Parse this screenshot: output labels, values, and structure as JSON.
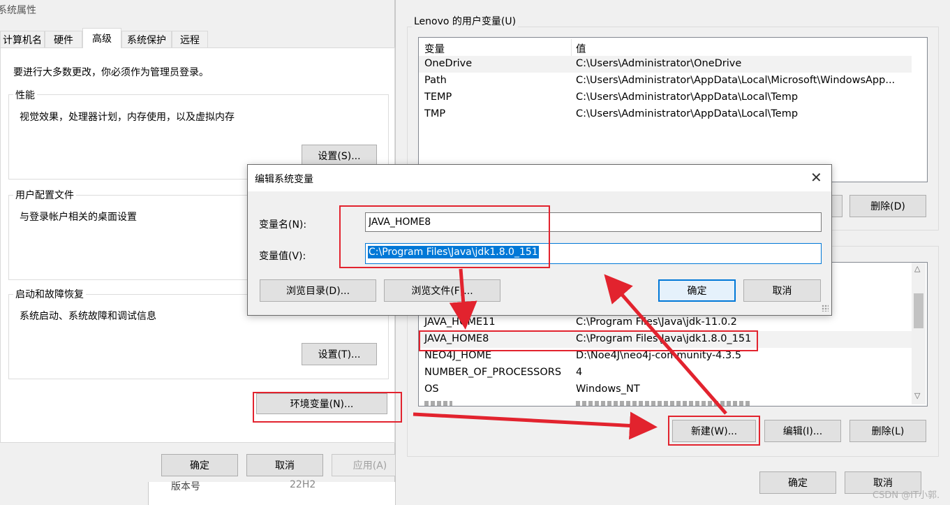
{
  "left_window": {
    "title": "系统属性",
    "tabs": [
      {
        "label": "计算机名"
      },
      {
        "label": "硬件"
      },
      {
        "label": "高级"
      },
      {
        "label": "系统保护"
      },
      {
        "label": "远程"
      }
    ],
    "admin_note": "要进行大多数更改，你必须作为管理员登录。",
    "performance": {
      "title": "性能",
      "desc": "视觉效果，处理器计划，内存使用，以及虚拟内存",
      "button": "设置(S)..."
    },
    "user_profiles": {
      "title": "用户配置文件",
      "desc": "与登录帐户相关的桌面设置"
    },
    "startup": {
      "title": "启动和故障恢复",
      "desc": "系统启动、系统故障和调试信息",
      "button": "设置(T)..."
    },
    "env_button": "环境变量(N)...",
    "ok": "确定",
    "cancel": "取消",
    "apply": "应用(A)",
    "behind_text_1": "版本号",
    "behind_text_2": "22H2"
  },
  "right_window": {
    "user_vars_title": "Lenovo 的用户变量(U)",
    "columns": {
      "name": "变量",
      "value": "值"
    },
    "user_vars": [
      {
        "name": "OneDrive",
        "value": "C:\\Users\\Administrator\\OneDrive"
      },
      {
        "name": "Path",
        "value": "C:\\Users\\Administrator\\AppData\\Local\\Microsoft\\WindowsApp..."
      },
      {
        "name": "TEMP",
        "value": "C:\\Users\\Administrator\\AppData\\Local\\Temp"
      },
      {
        "name": "TMP",
        "value": "C:\\Users\\Administrator\\AppData\\Local\\Temp"
      }
    ],
    "user_delete": "删除(D)",
    "system_vars": [
      {
        "name": "JAVA_HOME11",
        "value": "C:\\Program Files\\Java\\jdk-11.0.2"
      },
      {
        "name": "JAVA_HOME8",
        "value": "C:\\Program Files\\Java\\jdk1.8.0_151"
      },
      {
        "name": "NEO4J_HOME",
        "value": "D:\\Noe4J\\neo4j-community-4.3.5"
      },
      {
        "name": "NUMBER_OF_PROCESSORS",
        "value": "4"
      },
      {
        "name": "OS",
        "value": "Windows_NT"
      }
    ],
    "sys_new": "新建(W)...",
    "sys_edit": "编辑(I)...",
    "sys_delete": "删除(L)",
    "ok": "确定",
    "cancel": "取消"
  },
  "dialog": {
    "title": "编辑系统变量",
    "name_label": "变量名(N):",
    "name_value": "JAVA_HOME8",
    "value_label": "变量值(V):",
    "value_value": "C:\\Program Files\\Java\\jdk1.8.0_151",
    "browse_dir": "浏览目录(D)...",
    "browse_file": "浏览文件(F)...",
    "ok": "确定",
    "cancel": "取消"
  },
  "watermark": "CSDN @IT小郭.",
  "colors": {
    "annotation_red": "#e2232e",
    "accent": "#0078d7"
  }
}
